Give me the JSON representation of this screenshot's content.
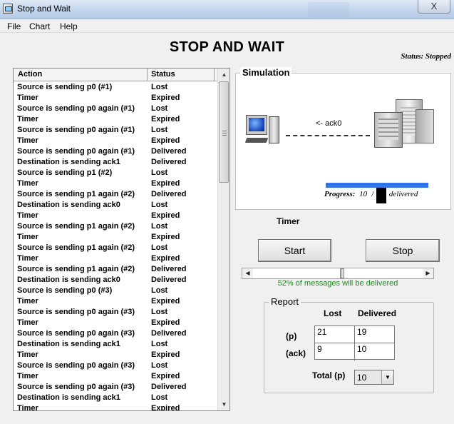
{
  "window": {
    "title": "Stop and Wait",
    "close_label": "X"
  },
  "menu": [
    "File",
    "Chart",
    "Help"
  ],
  "header": {
    "title": "STOP AND WAIT",
    "status": "Status: Stopped"
  },
  "log": {
    "col_action": "Action",
    "col_status": "Status",
    "rows": [
      [
        "Source is sending p0 (#1)",
        "Lost"
      ],
      [
        "Timer",
        "Expired"
      ],
      [
        "Source is sending p0 again (#1)",
        "Lost"
      ],
      [
        "Timer",
        "Expired"
      ],
      [
        "Source is sending p0 again (#1)",
        "Lost"
      ],
      [
        "Timer",
        "Expired"
      ],
      [
        "Source is sending p0 again (#1)",
        "Delivered"
      ],
      [
        "Destination is sending ack1",
        "Delivered"
      ],
      [
        "Source is sending p1 (#2)",
        "Lost"
      ],
      [
        "Timer",
        "Expired"
      ],
      [
        "Source is sending p1 again (#2)",
        "Delivered"
      ],
      [
        "Destination is sending ack0",
        "Lost"
      ],
      [
        "Timer",
        "Expired"
      ],
      [
        "Source is sending p1 again (#2)",
        "Lost"
      ],
      [
        "Timer",
        "Expired"
      ],
      [
        "Source is sending p1 again (#2)",
        "Lost"
      ],
      [
        "Timer",
        "Expired"
      ],
      [
        "Source is sending p1 again (#2)",
        "Delivered"
      ],
      [
        "Destination is sending ack0",
        "Delivered"
      ],
      [
        "Source is sending p0 (#3)",
        "Lost"
      ],
      [
        "Timer",
        "Expired"
      ],
      [
        "Source is sending p0 again (#3)",
        "Lost"
      ],
      [
        "Timer",
        "Expired"
      ],
      [
        "Source is sending p0 again (#3)",
        "Delivered"
      ],
      [
        "Destination is sending ack1",
        "Lost"
      ],
      [
        "Timer",
        "Expired"
      ],
      [
        "Source is sending p0 again (#3)",
        "Lost"
      ],
      [
        "Timer",
        "Expired"
      ],
      [
        "Source is sending p0 again (#3)",
        "Delivered"
      ],
      [
        "Destination is sending ack1",
        "Lost"
      ],
      [
        "Timer",
        "Expired"
      ]
    ]
  },
  "simulation": {
    "legend": "Simulation",
    "ack_label": "<- ack0",
    "progress_label": "Progress:",
    "progress_value": "10",
    "progress_sep": "/",
    "progress_suffix": "delivered"
  },
  "controls": {
    "timer_label": "Timer",
    "start_label": "Start",
    "stop_label": "Stop",
    "slider_fraction": 0.52,
    "delivery_text": "52% of messages will be delivered"
  },
  "report": {
    "legend": "Report",
    "col_lost": "Lost",
    "col_delivered": "Delivered",
    "row_p": "(p)",
    "row_ack": "(ack)",
    "p_lost": "21",
    "p_delivered": "19",
    "ack_lost": "9",
    "ack_delivered": "10",
    "total_label": "Total  (p)",
    "total_value": "10"
  },
  "colors": {
    "progress": "#2f77e8",
    "delivery_text": "#1e8a1e"
  }
}
